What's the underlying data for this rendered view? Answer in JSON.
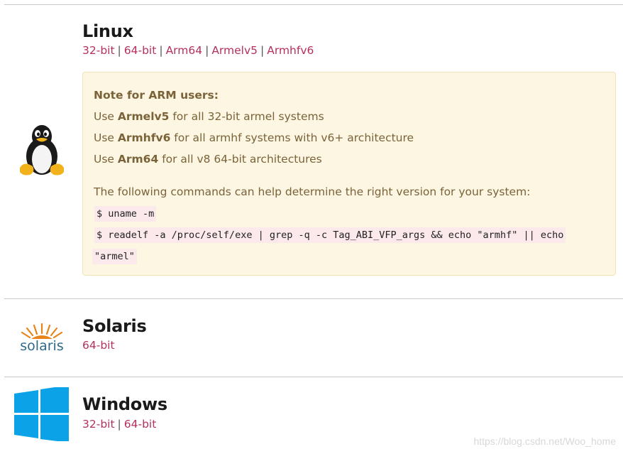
{
  "linux": {
    "title": "Linux",
    "links": [
      "32-bit",
      "64-bit",
      "Arm64",
      "Armelv5",
      "Armhfv6"
    ],
    "icon": "tux-penguin-icon",
    "note": {
      "heading": "Note for ARM users:",
      "lines": [
        {
          "prefix": "Use ",
          "bold": "Armelv5",
          "suffix": " for all 32-bit armel systems"
        },
        {
          "prefix": "Use ",
          "bold": "Armhfv6",
          "suffix": " for all armhf systems with v6+ architecture"
        },
        {
          "prefix": "Use ",
          "bold": "Arm64",
          "suffix": " for all v8 64-bit architectures"
        }
      ],
      "help_text": "The following commands can help determine the right version for your system:",
      "commands": [
        "$ uname -m",
        "$ readelf -a /proc/self/exe | grep -q -c Tag_ABI_VFP_args && echo \"armhf\" || echo",
        "\"armel\""
      ]
    }
  },
  "solaris": {
    "title": "Solaris",
    "links": [
      "64-bit"
    ],
    "icon": "solaris-logo-icon",
    "logo_text": "solaris"
  },
  "windows": {
    "title": "Windows",
    "links": [
      "32-bit",
      "64-bit"
    ],
    "icon": "windows-logo-icon"
  },
  "watermark": "https://blog.csdn.net/Woo_home",
  "colors": {
    "link": "#b5305f",
    "note_bg": "#fdf6e3",
    "note_text": "#7a6339",
    "code_bg": "#fbe9ec",
    "windows_blue": "#0ca2e8",
    "solaris_blue": "#2e6a8a",
    "solaris_orange": "#e8841a"
  }
}
